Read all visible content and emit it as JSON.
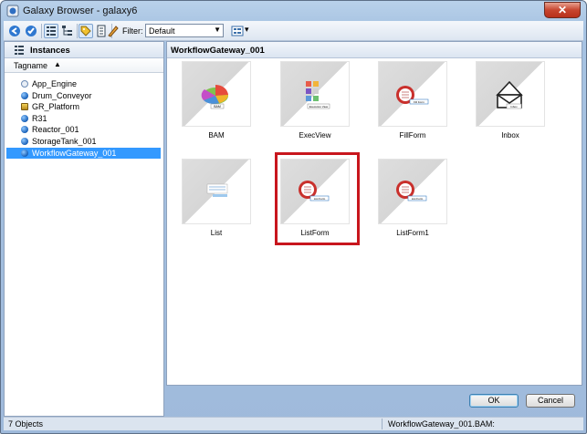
{
  "window": {
    "title": "Galaxy Browser - galaxy6",
    "close_label": "✕"
  },
  "toolbar": {
    "buttons": [
      "back-icon",
      "refresh-icon",
      "tree-view-icon",
      "hierarchy-view-icon",
      "tag-icon",
      "properties-icon",
      "edit-filter-icon"
    ],
    "filter_label": "Filter:",
    "filter_value": "Default",
    "view_dropdown_arrow": "▾"
  },
  "left_pane": {
    "header": "Instances",
    "column": "Tagname",
    "sort_indicator": "▲",
    "items": [
      {
        "label": "App_Engine",
        "icon": "engine-icon",
        "selected": false
      },
      {
        "label": "Drum_Conveyor",
        "icon": "object-icon",
        "selected": false
      },
      {
        "label": "GR_Platform",
        "icon": "platform-icon",
        "selected": false
      },
      {
        "label": "R31",
        "icon": "object-icon",
        "selected": false
      },
      {
        "label": "Reactor_001",
        "icon": "object-icon",
        "selected": false
      },
      {
        "label": "StorageTank_001",
        "icon": "object-icon",
        "selected": false
      },
      {
        "label": "WorkflowGateway_001",
        "icon": "object-icon",
        "selected": true
      }
    ]
  },
  "right_pane": {
    "header": "WorkflowGateway_001",
    "tiles": [
      {
        "label": "BAM",
        "thumb_caption": "BAM"
      },
      {
        "label": "ExecView",
        "thumb_caption": "Execution View"
      },
      {
        "label": "FillForm",
        "thumb_caption": "Fill Form"
      },
      {
        "label": "Inbox",
        "thumb_caption": "Inbox"
      },
      {
        "label": "List",
        "thumb_caption": ""
      },
      {
        "label": "ListForm",
        "thumb_caption": "List Form",
        "highlighted": true
      },
      {
        "label": "ListForm1",
        "thumb_caption": "List Form"
      }
    ]
  },
  "buttons": {
    "ok": "OK",
    "cancel": "Cancel"
  },
  "status": {
    "count": "7 Objects",
    "reference": "WorkflowGateway_001.BAM:"
  },
  "colors": {
    "selection": "#3399ff",
    "highlight_box": "#c8161d",
    "title_bar": "#b9d1ea"
  }
}
